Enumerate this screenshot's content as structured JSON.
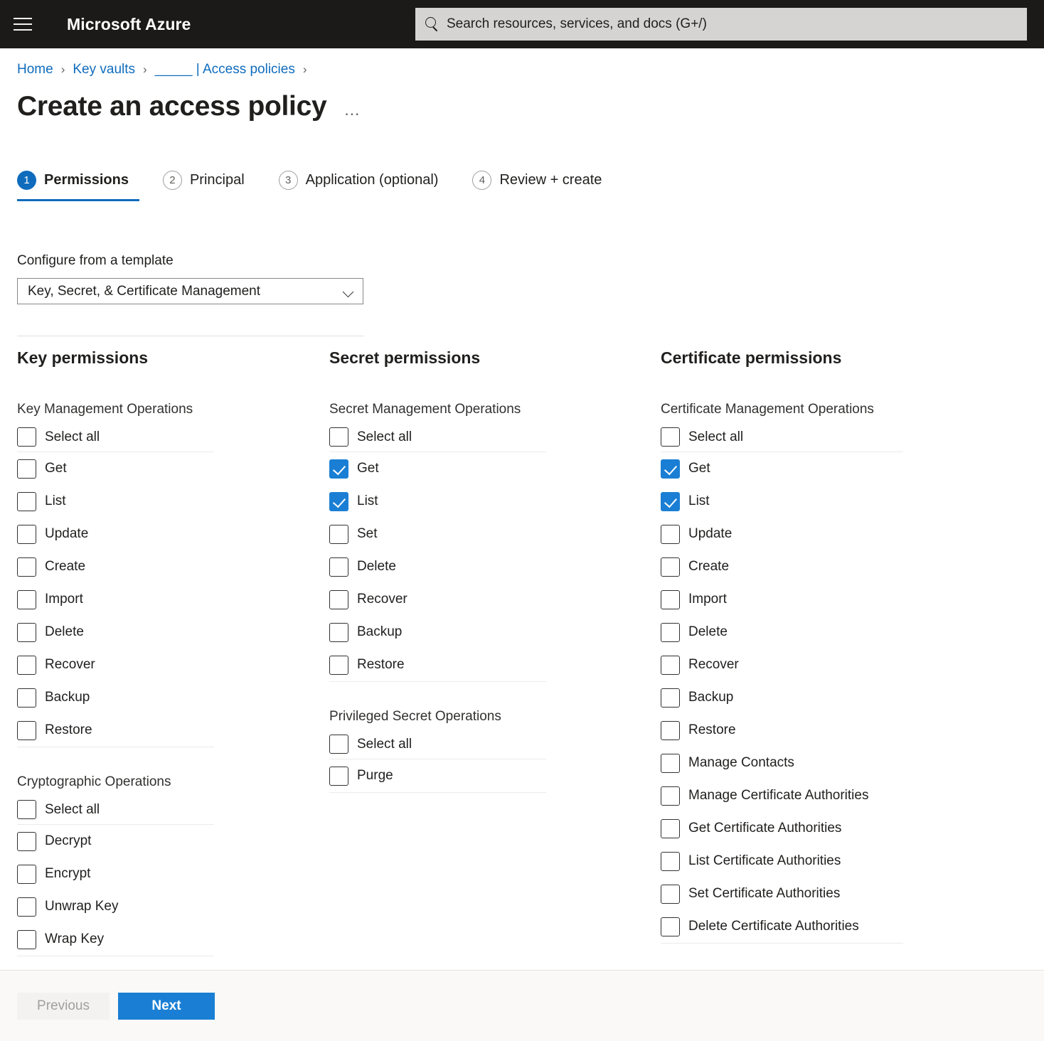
{
  "topbar": {
    "menu_icon": "hamburger-icon",
    "brand": "Microsoft Azure",
    "search": {
      "icon": "search-icon",
      "placeholder": "Search resources, services, and docs (G+/)"
    }
  },
  "breadcrumb": {
    "items": [
      "Home",
      "Key vaults",
      "_____ | Access policies"
    ],
    "separator": "›"
  },
  "page": {
    "title": "Create an access policy",
    "more_actions": "…"
  },
  "wizard": {
    "tabs": [
      {
        "num": "1",
        "label": "Permissions",
        "active": true
      },
      {
        "num": "2",
        "label": "Principal",
        "active": false
      },
      {
        "num": "3",
        "label": "Application (optional)",
        "active": false
      },
      {
        "num": "4",
        "label": "Review + create",
        "active": false
      }
    ]
  },
  "template": {
    "label": "Configure from a template",
    "value": "Key, Secret, & Certificate Management",
    "chevron_icon": "chevron-down-icon"
  },
  "columns": [
    {
      "title": "Key permissions",
      "groups": [
        {
          "title": "Key Management Operations",
          "select_all": {
            "label": "Select all",
            "checked": false
          },
          "items": [
            {
              "label": "Get",
              "checked": false
            },
            {
              "label": "List",
              "checked": false
            },
            {
              "label": "Update",
              "checked": false
            },
            {
              "label": "Create",
              "checked": false
            },
            {
              "label": "Import",
              "checked": false
            },
            {
              "label": "Delete",
              "checked": false
            },
            {
              "label": "Recover",
              "checked": false
            },
            {
              "label": "Backup",
              "checked": false
            },
            {
              "label": "Restore",
              "checked": false
            }
          ]
        },
        {
          "title": "Cryptographic Operations",
          "select_all": {
            "label": "Select all",
            "checked": false
          },
          "items": [
            {
              "label": "Decrypt",
              "checked": false
            },
            {
              "label": "Encrypt",
              "checked": false
            },
            {
              "label": "Unwrap Key",
              "checked": false
            },
            {
              "label": "Wrap Key",
              "checked": false
            }
          ]
        }
      ]
    },
    {
      "title": "Secret permissions",
      "groups": [
        {
          "title": "Secret Management Operations",
          "select_all": {
            "label": "Select all",
            "checked": false
          },
          "items": [
            {
              "label": "Get",
              "checked": true
            },
            {
              "label": "List",
              "checked": true
            },
            {
              "label": "Set",
              "checked": false
            },
            {
              "label": "Delete",
              "checked": false
            },
            {
              "label": "Recover",
              "checked": false
            },
            {
              "label": "Backup",
              "checked": false
            },
            {
              "label": "Restore",
              "checked": false
            }
          ]
        },
        {
          "title": "Privileged Secret Operations",
          "select_all": {
            "label": "Select all",
            "checked": false
          },
          "items": [
            {
              "label": "Purge",
              "checked": false
            }
          ]
        }
      ]
    },
    {
      "title": "Certificate permissions",
      "groups": [
        {
          "title": "Certificate Management Operations",
          "select_all": {
            "label": "Select all",
            "checked": false
          },
          "items": [
            {
              "label": "Get",
              "checked": true
            },
            {
              "label": "List",
              "checked": true
            },
            {
              "label": "Update",
              "checked": false
            },
            {
              "label": "Create",
              "checked": false
            },
            {
              "label": "Import",
              "checked": false
            },
            {
              "label": "Delete",
              "checked": false
            },
            {
              "label": "Recover",
              "checked": false
            },
            {
              "label": "Backup",
              "checked": false
            },
            {
              "label": "Restore",
              "checked": false
            },
            {
              "label": "Manage Contacts",
              "checked": false
            },
            {
              "label": "Manage Certificate Authorities",
              "checked": false
            },
            {
              "label": "Get Certificate Authorities",
              "checked": false
            },
            {
              "label": "List Certificate Authorities",
              "checked": false
            },
            {
              "label": "Set Certificate Authorities",
              "checked": false
            },
            {
              "label": "Delete Certificate Authorities",
              "checked": false
            }
          ]
        }
      ]
    }
  ],
  "footer": {
    "previous_label": "Previous",
    "next_label": "Next"
  },
  "colors": {
    "accent": "#0f6cbd",
    "checkbox_checked": "#1a7fd4",
    "topbar": "#1b1a19",
    "footer": "#faf9f8"
  }
}
